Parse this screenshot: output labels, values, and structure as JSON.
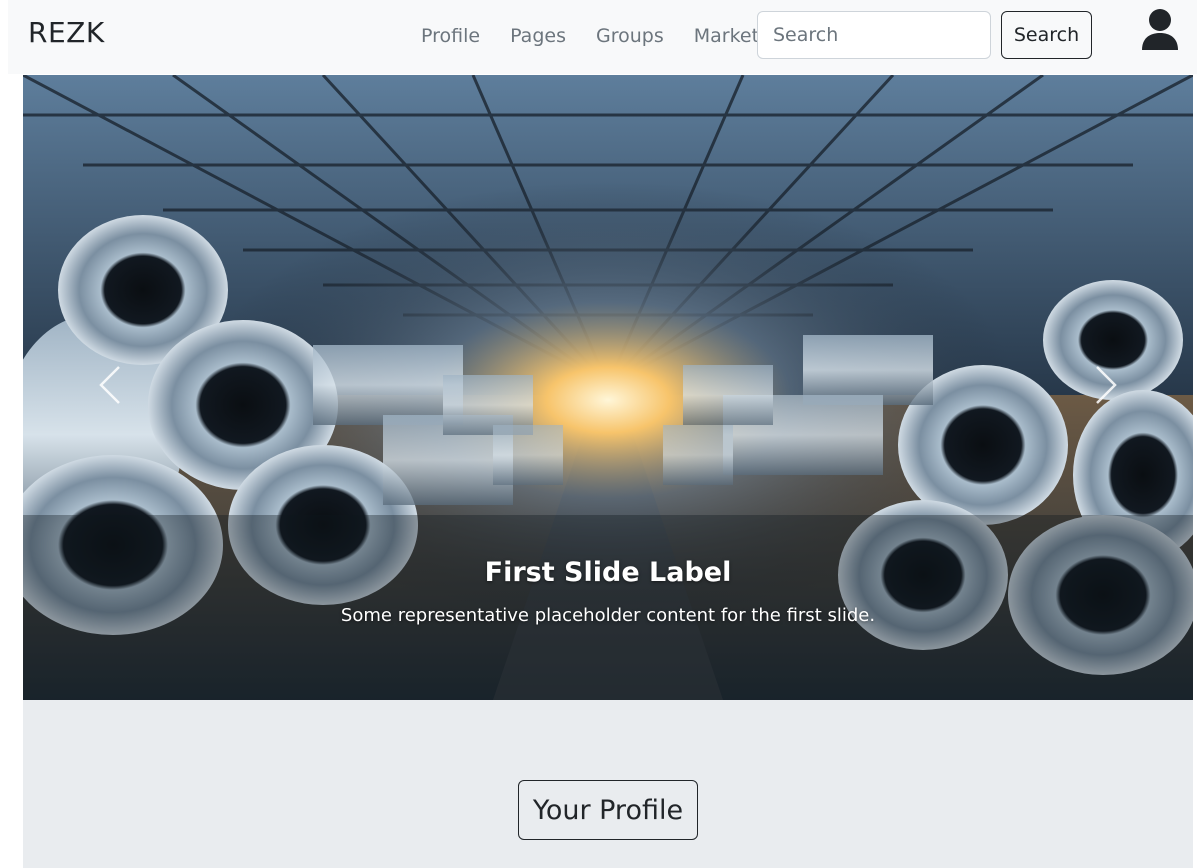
{
  "navbar": {
    "brand": "REZK",
    "links": [
      {
        "label": "Profile"
      },
      {
        "label": "Pages"
      },
      {
        "label": "Groups"
      },
      {
        "label": "Market"
      }
    ],
    "search": {
      "placeholder": "Search",
      "value": "",
      "button_label": "Search"
    },
    "user_icon": "person-icon",
    "background_color": "#f8f9fa"
  },
  "carousel": {
    "slide_image": "steel-coils-warehouse-photo",
    "caption_title": "First Slide Label",
    "caption_text": "Some representative placeholder content for the first slide.",
    "prev_icon": "chevron-left-icon",
    "next_icon": "chevron-right-icon"
  },
  "profile_section": {
    "button_label": "Your Profile",
    "background_color": "#e9ecef"
  }
}
